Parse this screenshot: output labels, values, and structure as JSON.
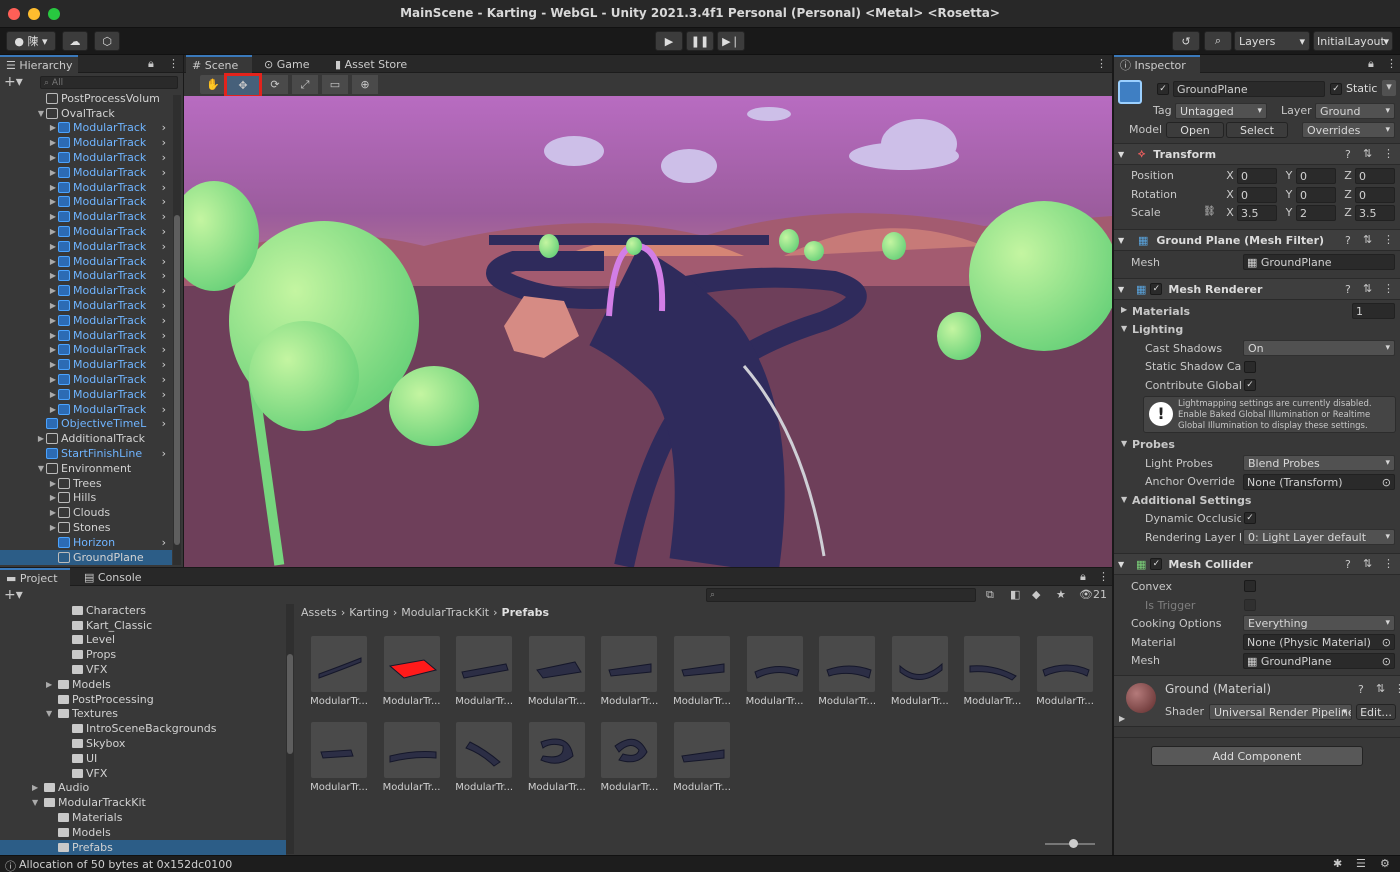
{
  "window": {
    "title": "MainScene - Karting - WebGL - Unity 2021.3.4f1 Personal (Personal) <Metal> <Rosetta>"
  },
  "toolbar": {
    "account": "陳",
    "layers": "Layers",
    "layout": "InitialLayout"
  },
  "hierarchy": {
    "tab": "Hierarchy",
    "search_placeholder": "All",
    "items": [
      {
        "label": "PostProcessVolum",
        "indent": 1,
        "blue": false,
        "arrow": ""
      },
      {
        "label": "OvalTrack",
        "indent": 1,
        "blue": false,
        "arrow": "▼"
      },
      {
        "label": "ModularTrack",
        "indent": 2,
        "blue": true,
        "arrow": "▶"
      },
      {
        "label": "ModularTrack",
        "indent": 2,
        "blue": true,
        "arrow": "▶"
      },
      {
        "label": "ModularTrack",
        "indent": 2,
        "blue": true,
        "arrow": "▶"
      },
      {
        "label": "ModularTrack",
        "indent": 2,
        "blue": true,
        "arrow": "▶"
      },
      {
        "label": "ModularTrack",
        "indent": 2,
        "blue": true,
        "arrow": "▶"
      },
      {
        "label": "ModularTrack",
        "indent": 2,
        "blue": true,
        "arrow": "▶"
      },
      {
        "label": "ModularTrack",
        "indent": 2,
        "blue": true,
        "arrow": "▶"
      },
      {
        "label": "ModularTrack",
        "indent": 2,
        "blue": true,
        "arrow": "▶"
      },
      {
        "label": "ModularTrack",
        "indent": 2,
        "blue": true,
        "arrow": "▶"
      },
      {
        "label": "ModularTrack",
        "indent": 2,
        "blue": true,
        "arrow": "▶"
      },
      {
        "label": "ModularTrack",
        "indent": 2,
        "blue": true,
        "arrow": "▶"
      },
      {
        "label": "ModularTrack",
        "indent": 2,
        "blue": true,
        "arrow": "▶"
      },
      {
        "label": "ModularTrack",
        "indent": 2,
        "blue": true,
        "arrow": "▶"
      },
      {
        "label": "ModularTrack",
        "indent": 2,
        "blue": true,
        "arrow": "▶"
      },
      {
        "label": "ModularTrack",
        "indent": 2,
        "blue": true,
        "arrow": "▶"
      },
      {
        "label": "ModularTrack",
        "indent": 2,
        "blue": true,
        "arrow": "▶"
      },
      {
        "label": "ModularTrack",
        "indent": 2,
        "blue": true,
        "arrow": "▶"
      },
      {
        "label": "ModularTrack",
        "indent": 2,
        "blue": true,
        "arrow": "▶"
      },
      {
        "label": "ModularTrack",
        "indent": 2,
        "blue": true,
        "arrow": "▶"
      },
      {
        "label": "ModularTrack",
        "indent": 2,
        "blue": true,
        "arrow": "▶"
      },
      {
        "label": "ObjectiveTimeL",
        "indent": 1,
        "blue": true,
        "arrow": ""
      },
      {
        "label": "AdditionalTrack",
        "indent": 1,
        "blue": false,
        "arrow": "▶"
      },
      {
        "label": "StartFinishLine",
        "indent": 1,
        "blue": true,
        "arrow": ""
      },
      {
        "label": "Environment",
        "indent": 1,
        "blue": false,
        "arrow": "▼"
      },
      {
        "label": "Trees",
        "indent": 2,
        "blue": false,
        "arrow": "▶"
      },
      {
        "label": "Hills",
        "indent": 2,
        "blue": false,
        "arrow": "▶"
      },
      {
        "label": "Clouds",
        "indent": 2,
        "blue": false,
        "arrow": "▶"
      },
      {
        "label": "Stones",
        "indent": 2,
        "blue": false,
        "arrow": "▶"
      },
      {
        "label": "Horizon",
        "indent": 2,
        "blue": true,
        "arrow": ""
      },
      {
        "label": "GroundPlane",
        "indent": 2,
        "blue": false,
        "arrow": "",
        "selected": true
      }
    ]
  },
  "scene": {
    "tabs": [
      "Scene",
      "Game",
      "Asset Store"
    ]
  },
  "project": {
    "tabs": [
      "Project",
      "Console"
    ],
    "count": "21",
    "breadcrumb": [
      "Assets",
      "Karting",
      "ModularTrackKit",
      "Prefabs"
    ],
    "tree": [
      {
        "label": "Characters",
        "indent": 3
      },
      {
        "label": "Kart_Classic",
        "indent": 3
      },
      {
        "label": "Level",
        "indent": 3
      },
      {
        "label": "Props",
        "indent": 3
      },
      {
        "label": "VFX",
        "indent": 3
      },
      {
        "label": "Models",
        "indent": 2,
        "arrow": "▶"
      },
      {
        "label": "PostProcessing",
        "indent": 2
      },
      {
        "label": "Textures",
        "indent": 2,
        "arrow": "▼"
      },
      {
        "label": "IntroSceneBackgrounds",
        "indent": 3
      },
      {
        "label": "Skybox",
        "indent": 3
      },
      {
        "label": "UI",
        "indent": 3
      },
      {
        "label": "VFX",
        "indent": 3
      },
      {
        "label": "Audio",
        "indent": 1,
        "arrow": "▶"
      },
      {
        "label": "ModularTrackKit",
        "indent": 1,
        "arrow": "▼"
      },
      {
        "label": "Materials",
        "indent": 2
      },
      {
        "label": "Models",
        "indent": 2
      },
      {
        "label": "Prefabs",
        "indent": 2,
        "selected": true
      }
    ],
    "assets": [
      "ModularTr...",
      "ModularTr...",
      "ModularTr...",
      "ModularTr...",
      "ModularTr...",
      "ModularTr...",
      "ModularTr...",
      "ModularTr...",
      "ModularTr...",
      "ModularTr...",
      "ModularTr...",
      "ModularTr...",
      "ModularTr...",
      "ModularTr...",
      "ModularTr...",
      "ModularTr...",
      "ModularTr..."
    ]
  },
  "status": {
    "text": "Allocation of 50 bytes at 0x152dc0100"
  },
  "inspector": {
    "tab": "Inspector",
    "name": "GroundPlane",
    "static": "Static",
    "tag_label": "Tag",
    "tag": "Untagged",
    "layer_label": "Layer",
    "layer": "Ground",
    "model_label": "Model",
    "open": "Open",
    "select": "Select",
    "overrides": "Overrides",
    "transform": {
      "title": "Transform",
      "position": [
        "0",
        "0",
        "0"
      ],
      "rotation": [
        "0",
        "0",
        "0"
      ],
      "scale": [
        "3.5",
        "2",
        "3.5"
      ],
      "pos_label": "Position",
      "rot_label": "Rotation",
      "scale_label": "Scale"
    },
    "meshfilter": {
      "title": "Ground Plane (Mesh Filter)",
      "mesh_label": "Mesh",
      "mesh": "GroundPlane"
    },
    "renderer": {
      "title": "Mesh Renderer",
      "materials": "Materials",
      "materials_count": "1",
      "lighting": "Lighting",
      "cast_shadows": "Cast Shadows",
      "cast_shadows_val": "On",
      "static_shadow": "Static Shadow Cas",
      "contribute": "Contribute Global I",
      "info": "Lightmapping settings are currently disabled. Enable Baked Global Illumination or Realtime Global Illumination to display these settings.",
      "probes": "Probes",
      "light_probes": "Light Probes",
      "light_probes_val": "Blend Probes",
      "anchor": "Anchor Override",
      "anchor_val": "None (Transform)",
      "additional": "Additional Settings",
      "dynamic": "Dynamic Occlusion",
      "rendering_layer": "Rendering Layer M",
      "rendering_layer_val": "0: Light Layer default"
    },
    "collider": {
      "title": "Mesh Collider",
      "convex": "Convex",
      "trigger": "Is Trigger",
      "cooking": "Cooking Options",
      "cooking_val": "Everything",
      "material": "Material",
      "material_val": "None (Physic Material)",
      "mesh": "Mesh",
      "mesh_val": "GroundPlane"
    },
    "material": {
      "title": "Ground (Material)",
      "shader_label": "Shader",
      "shader": "Universal Render Pipeline",
      "edit": "Edit..."
    },
    "add_component": "Add Component"
  },
  "colors": {
    "accent": "#3a79bb",
    "selection": "#2c5d87",
    "highlight": "#e3231c"
  }
}
